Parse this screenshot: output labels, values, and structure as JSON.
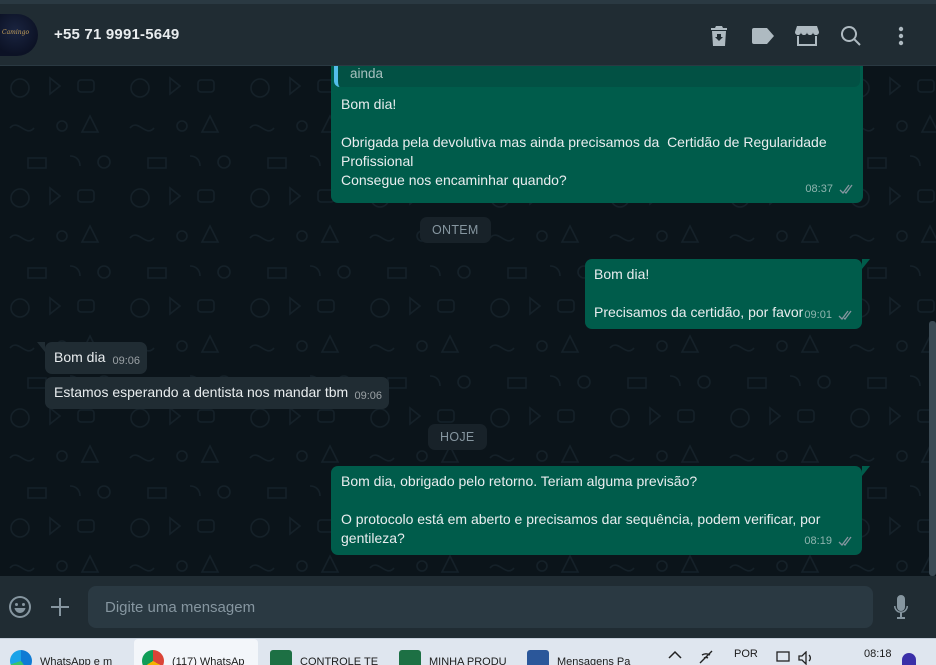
{
  "header": {
    "contact_name": "+55 71 9991-5649",
    "avatar_text": "Camingo",
    "icons": [
      "delete-icon",
      "label-icon",
      "store-icon",
      "search-icon",
      "menu-icon"
    ]
  },
  "messages": {
    "m1": {
      "quote": "ainda",
      "text": "Bom dia!\n\nObrigada pela devolutiva mas ainda precisamos da  Certidão de Regularidade Profissional\nConsegue nos encaminhar quando?",
      "time": "08:37"
    },
    "date1": "ONTEM",
    "m2": {
      "text": "Bom dia!\n\nPrecisamos da certidão, por favor",
      "time": "09:01"
    },
    "m3": {
      "text": "Bom dia",
      "time": "09:06"
    },
    "m4": {
      "text": "Estamos esperando a dentista nos mandar tbm",
      "time": "09:06"
    },
    "date2": "HOJE",
    "m5": {
      "text": "Bom dia, obrigado pelo retorno. Teriam alguma previsão?\n\nO protocolo está em aberto e precisamos dar sequência, podem verificar, por gentileza?",
      "time": "08:19"
    }
  },
  "composer": {
    "placeholder": "Digite uma mensagem"
  },
  "taskbar": {
    "items": [
      {
        "label": "WhatsApp e m"
      },
      {
        "label": "(117) WhatsAp"
      },
      {
        "label": "CONTROLE TE"
      },
      {
        "label": "MINHA PRODU"
      },
      {
        "label": "Mensagens Pa"
      }
    ],
    "lang": "POR",
    "clock": "08:18"
  },
  "colors": {
    "outgoing_bubble": "#005c4b",
    "incoming_bubble": "#202c33",
    "chat_bg": "#0b141a",
    "header_bg": "#202c33",
    "read_ticks": "#8696a0"
  }
}
